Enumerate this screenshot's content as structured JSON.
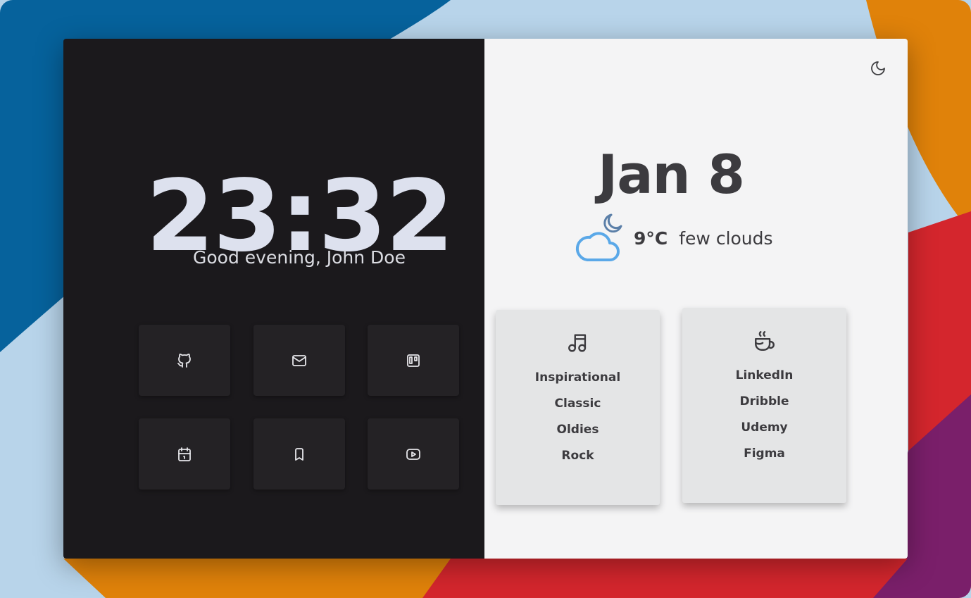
{
  "clock": {
    "time": "23:32",
    "greeting": "Good evening, John Doe"
  },
  "shortcuts": [
    {
      "icon": "github-icon"
    },
    {
      "icon": "mail-icon"
    },
    {
      "icon": "trello-icon"
    },
    {
      "icon": "calendar-icon"
    },
    {
      "icon": "bookmark-icon"
    },
    {
      "icon": "youtube-icon"
    }
  ],
  "theme_toggle": {
    "icon": "moon-icon"
  },
  "date": "Jan 8",
  "weather": {
    "icon": "cloud-moon-icon",
    "temperature": "9°C",
    "condition": "few clouds",
    "icon_color": "#5aa8e8"
  },
  "music_card": {
    "icon": "music-icon",
    "items": [
      "Inspirational",
      "Classic",
      "Oldies",
      "Rock"
    ]
  },
  "links_card": {
    "icon": "coffee-icon",
    "items": [
      "LinkedIn",
      "Dribble",
      "Udemy",
      "Figma"
    ]
  },
  "colors": {
    "left_bg": "#1b191c",
    "right_bg": "#f4f4f5",
    "tile_bg": "#242225",
    "card_bg": "#e4e5e6",
    "text_dark": "#3c3b3f",
    "clock_text": "#dde1ee"
  }
}
